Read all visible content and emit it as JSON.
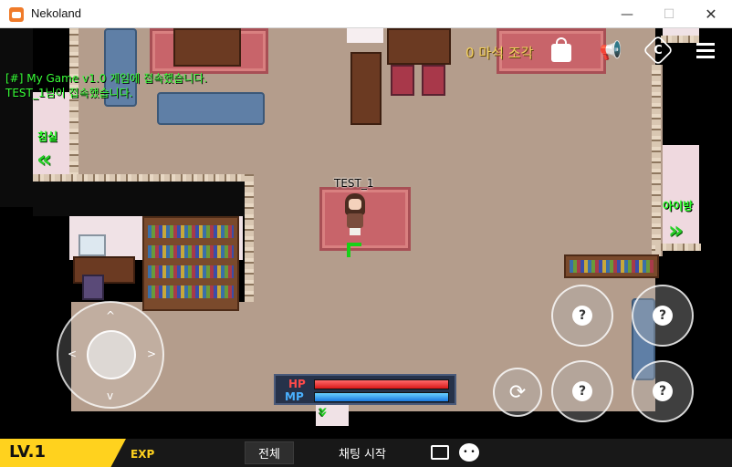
{
  "window": {
    "title": "Nekoland",
    "minimize": "—",
    "maximize": "☐",
    "close": "✕"
  },
  "system_log": [
    "[#] My Game v1.0 게임에 접속했습니다.",
    "TEST_1님이 접속했습니다."
  ],
  "rooms": {
    "bedroom": "침실",
    "kids_room": "아이방"
  },
  "player": {
    "name": "TEST_1"
  },
  "hud": {
    "shards_text": "0 마석 조각",
    "icons": [
      "shopping-bag-icon",
      "megaphone-icon",
      "coin-icon",
      "menu-icon"
    ]
  },
  "status": {
    "hp_label": "HP",
    "mp_label": "MP",
    "hp_fraction": 1.0,
    "mp_fraction": 1.0,
    "hp_color": "#d81818",
    "mp_color": "#1a78e0"
  },
  "action_buttons": {
    "unknown_glyph": "?",
    "switch_icon": "refresh-icon"
  },
  "joystick": {
    "up": "^",
    "down": "v",
    "left": "<",
    "right": ">"
  },
  "bottom_bar": {
    "level": "LV.1",
    "exp_label": "EXP",
    "tab_all": "전체",
    "tab_chat_start": "채팅 시작",
    "level_badge_color": "#ffd21e"
  }
}
